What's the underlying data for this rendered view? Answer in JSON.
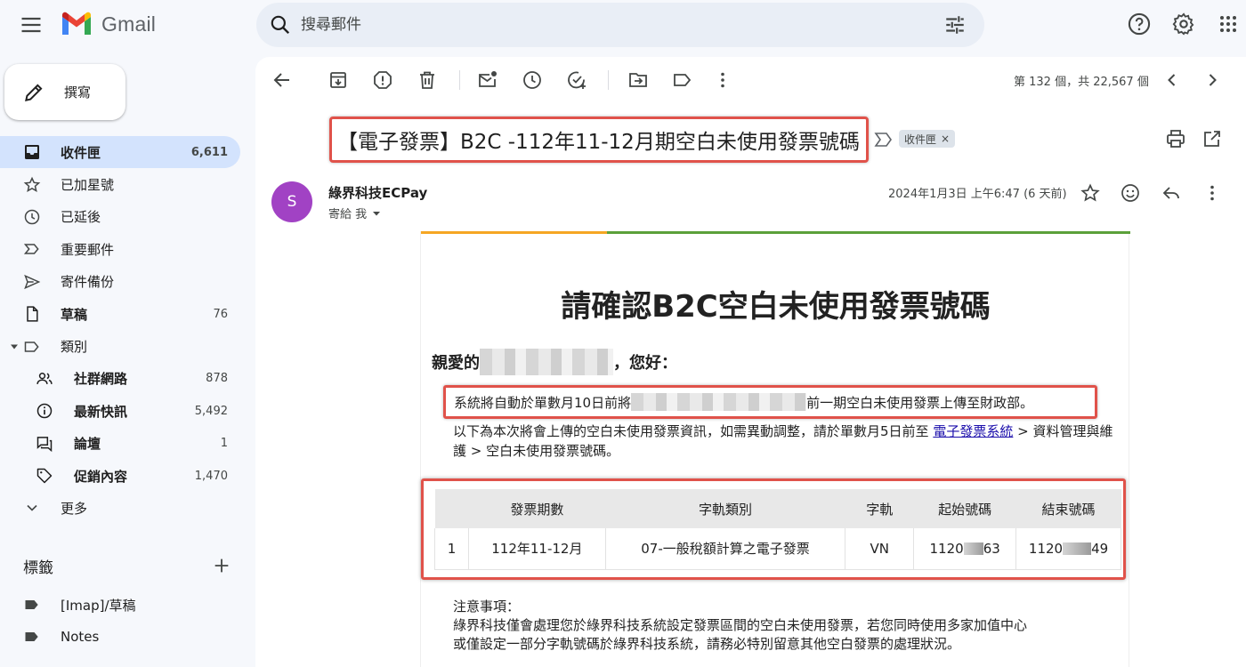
{
  "header": {
    "app_name": "Gmail",
    "search_placeholder": "搜尋郵件"
  },
  "compose": {
    "label": "撰寫"
  },
  "nav": [
    {
      "label": "收件匣",
      "count": "6,611"
    },
    {
      "label": "已加星號",
      "count": ""
    },
    {
      "label": "已延後",
      "count": ""
    },
    {
      "label": "重要郵件",
      "count": ""
    },
    {
      "label": "寄件備份",
      "count": ""
    },
    {
      "label": "草稿",
      "count": "76"
    },
    {
      "label": "類別",
      "count": ""
    },
    {
      "label": "社群網路",
      "count": "878"
    },
    {
      "label": "最新快訊",
      "count": "5,492"
    },
    {
      "label": "論壇",
      "count": "1"
    },
    {
      "label": "促銷內容",
      "count": "1,470"
    },
    {
      "label": "更多",
      "count": ""
    }
  ],
  "labels": {
    "heading": "標籤",
    "items": [
      {
        "label": "[Imap]/草稿"
      },
      {
        "label": "Notes"
      }
    ]
  },
  "toolbar": {
    "pager": "第 132 個，共 22,567 個"
  },
  "message": {
    "subject": "【電子發票】B2C -112年11-12月期空白未使用發票號碼",
    "chip": "收件匣",
    "chip_close": "×",
    "avatar_letter": "S",
    "sender": "綠界科技ECPay",
    "to": "寄給 我",
    "date": "2024年1月3日 上午6:47 (6 天前)"
  },
  "email": {
    "title": "請確認B2C空白未使用發票號碼",
    "greeting_prefix": "親愛的",
    "greeting_suffix": "，您好：",
    "notice_prefix": "系統將自動於單數月10日前將",
    "notice_suffix": "前一期空白未使用發票上傳至財政部。",
    "para_text1": "以下為本次將會上傳的空白未使用發票資訊，如需異動調整，請於單數月5日前至 ",
    "para_link": "電子發票系統",
    "para_text2": " > 資料管理與維護 > 空白未使用發票號碼。",
    "table": {
      "headers": [
        "",
        "發票期數",
        "字軌類別",
        "字軌",
        "起始號碼",
        "結束號碼"
      ],
      "row": {
        "index": "1",
        "period": "112年11-12月",
        "category": "07-一般稅額計算之電子發票",
        "track": "VN",
        "start_a": "1120",
        "start_b": "63",
        "end_a": "1120",
        "end_b": "49"
      }
    },
    "notes_title": "注意事項：",
    "notes_line1": "綠界科技僅會處理您於綠界科技系統設定發票區間的空白未使用發票，若您同時使用多家加值中心",
    "notes_line2": "或僅設定一部分字軌號碼於綠界科技系統，請務必特別留意其他空白發票的處理狀況。"
  },
  "colors": {
    "bg": "#f6f8fc",
    "active_nav": "#d3e3fd",
    "highlight": "#e0524a",
    "avatar": "#a142c4",
    "link": "#1a0dab",
    "gmail_red": "#ea4335",
    "gmail_blue": "#4285f4",
    "gmail_green": "#34a853",
    "gmail_yellow": "#fbbc04"
  },
  "icons": {
    "header": [
      "menu-icon",
      "search-icon",
      "tune-icon",
      "help-icon",
      "settings-icon",
      "apps-icon"
    ],
    "toolbar": [
      "back-arrow-icon",
      "archive-icon",
      "report-spam-icon",
      "delete-icon",
      "mark-unread-icon",
      "snooze-icon",
      "add-task-icon",
      "move-to-icon",
      "label-icon",
      "more-vert-icon",
      "prev-icon",
      "next-icon"
    ]
  }
}
